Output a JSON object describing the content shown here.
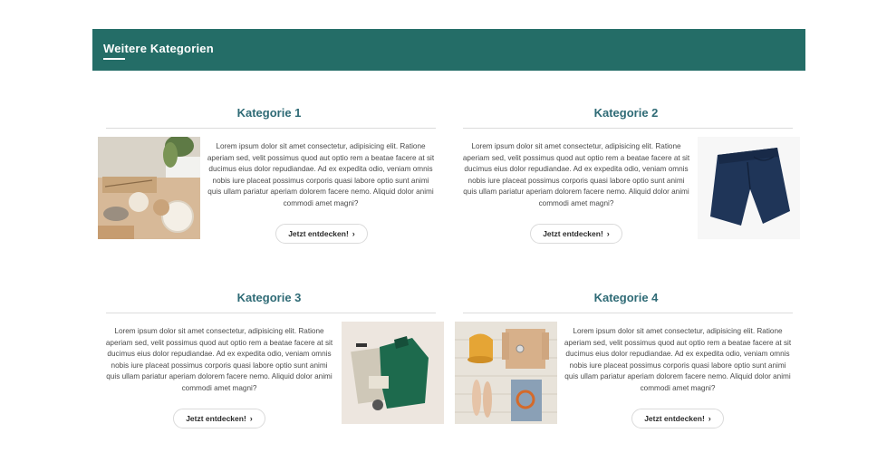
{
  "section": {
    "title": "Weitere Kategorien"
  },
  "categories": [
    {
      "title": "Kategorie 1",
      "text": "Lorem ipsum dolor sit amet consectetur, adipisicing elit. Ratione aperiam sed, velit possimus quod aut optio rem a beatae facere at sit ducimus eius dolor repudiandae. Ad ex expedita odio, veniam omnis nobis iure placeat possimus corporis quasi labore optio sunt animi quis ullam pariatur aperiam dolorem facere nemo. Aliquid dolor animi commodi amet magni?",
      "button": "Jetzt entdecken!",
      "image": "yarn-knitting-image"
    },
    {
      "title": "Kategorie 2",
      "text": "Lorem ipsum dolor sit amet consectetur, adipisicing elit. Ratione aperiam sed, velit possimus quod aut optio rem a beatae facere at sit ducimus eius dolor repudiandae. Ad ex expedita odio, veniam omnis nobis iure placeat possimus corporis quasi labore optio sunt animi quis ullam pariatur aperiam dolorem facere nemo. Aliquid dolor animi commodi amet magni?",
      "button": "Jetzt entdecken!",
      "image": "navy-shorts-image"
    },
    {
      "title": "Kategorie 3",
      "text": "Lorem ipsum dolor sit amet consectetur, adipisicing elit. Ratione aperiam sed, velit possimus quod aut optio rem a beatae facere at sit ducimus eius dolor repudiandae. Ad ex expedita odio, veniam omnis nobis iure placeat possimus corporis quasi labore optio sunt animi quis ullam pariatur aperiam dolorem facere nemo. Aliquid dolor animi commodi amet magni?",
      "button": "Jetzt entdecken!",
      "image": "green-sweater-outfit-image"
    },
    {
      "title": "Kategorie 4",
      "text": "Lorem ipsum dolor sit amet consectetur, adipisicing elit. Ratione aperiam sed, velit possimus quod aut optio rem a beatae facere at sit ducimus eius dolor repudiandae. Ad ex expedita odio, veniam omnis nobis iure placeat possimus corporis quasi labore optio sunt animi quis ullam pariatur aperiam dolorem facere nemo. Aliquid dolor animi commodi amet magni?",
      "button": "Jetzt entdecken!",
      "image": "summer-outfit-flatlay-image"
    }
  ],
  "colors": {
    "banner": "#246d67",
    "title": "#2f6b76"
  }
}
